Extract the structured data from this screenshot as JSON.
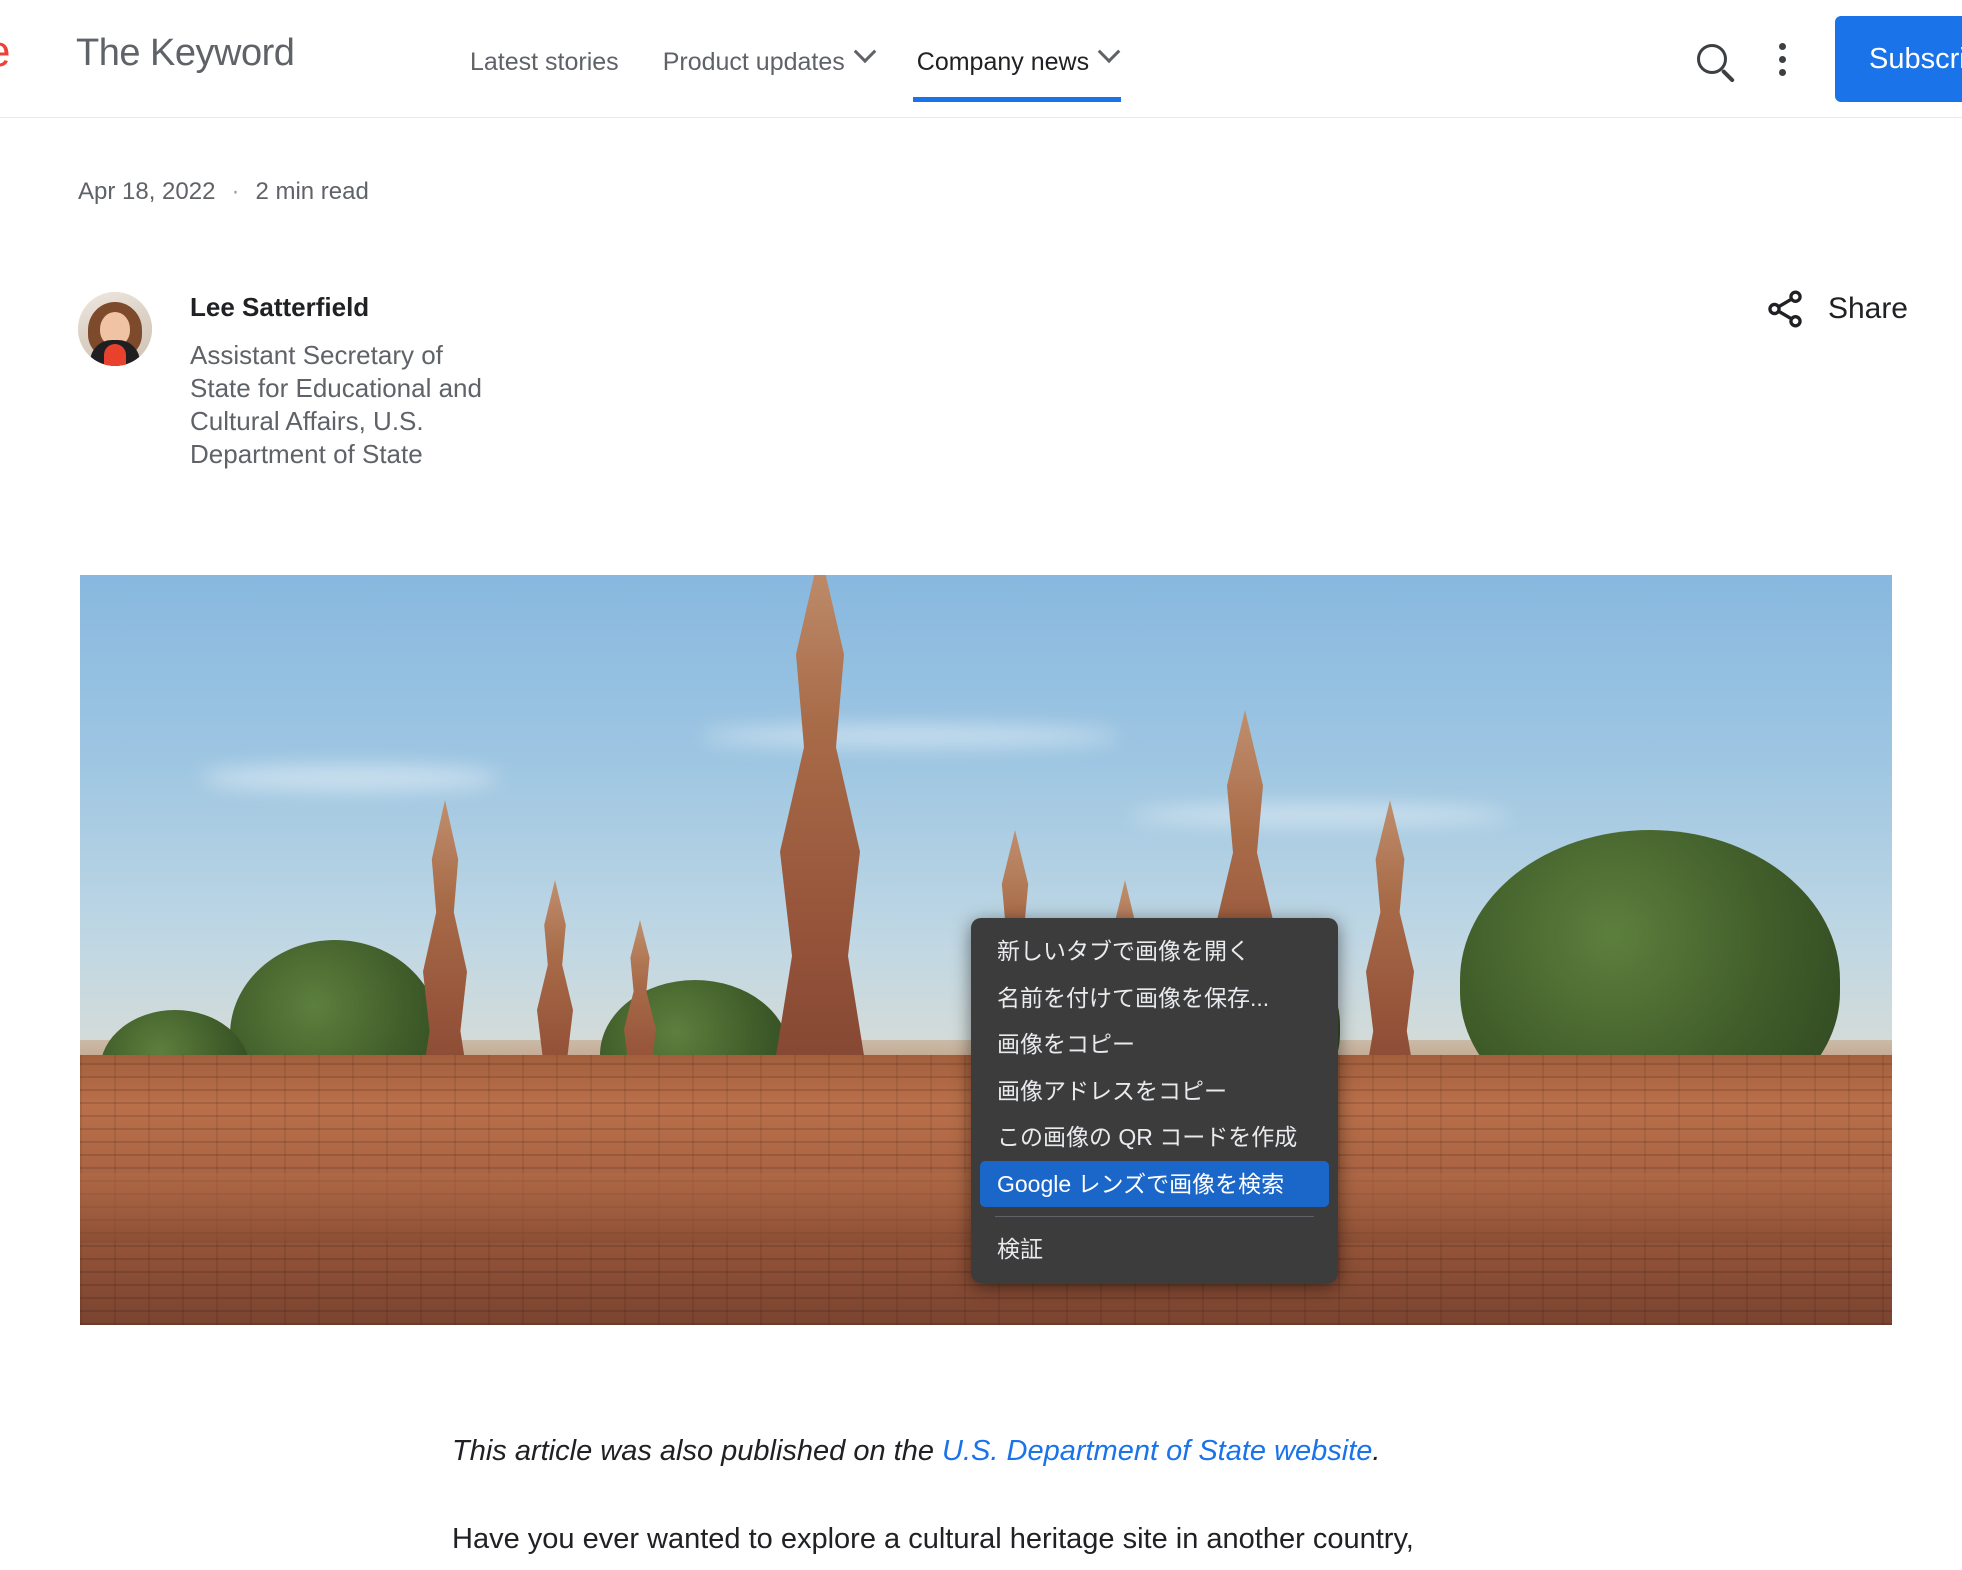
{
  "header": {
    "logo_fragment": "e",
    "brand": "The Keyword",
    "nav": [
      {
        "label": "Latest stories",
        "has_dropdown": false,
        "active": false
      },
      {
        "label": "Product updates",
        "has_dropdown": true,
        "active": false
      },
      {
        "label": "Company news",
        "has_dropdown": true,
        "active": true
      }
    ],
    "search_icon": "search-icon",
    "overflow_icon": "more-vertical-icon",
    "subscribe_label": "Subscribe",
    "accent_color": "#1a73e8"
  },
  "article": {
    "date": "Apr 18, 2022",
    "separator": "·",
    "read_time": "2 min read",
    "author": {
      "name": "Lee Satterfield",
      "title": "Assistant Secretary of State for Educational and Cultural Affairs, U.S. Department of State"
    },
    "share": {
      "label": "Share",
      "icon": "share-icon"
    },
    "lede_prefix": "This article was also published on the ",
    "lede_link": "U.S. Department of State website",
    "lede_suffix": ".",
    "paragraph": "Have you ever wanted to explore a cultural heritage site in another country,"
  },
  "hero_image": {
    "alt": "Ancient Thai temple ruins with brick prang spires under a blue sky"
  },
  "context_menu": {
    "items": [
      {
        "label": "新しいタブで画像を開く",
        "highlighted": false
      },
      {
        "label": "名前を付けて画像を保存...",
        "highlighted": false
      },
      {
        "label": "画像をコピー",
        "highlighted": false
      },
      {
        "label": "画像アドレスをコピー",
        "highlighted": false
      },
      {
        "label": "この画像の QR コードを作成",
        "highlighted": false
      },
      {
        "label": "Google レンズで画像を検索",
        "highlighted": true
      }
    ],
    "footer_item": "検証",
    "highlight_color": "#1b66c9",
    "background_color": "#3c3c3c"
  }
}
